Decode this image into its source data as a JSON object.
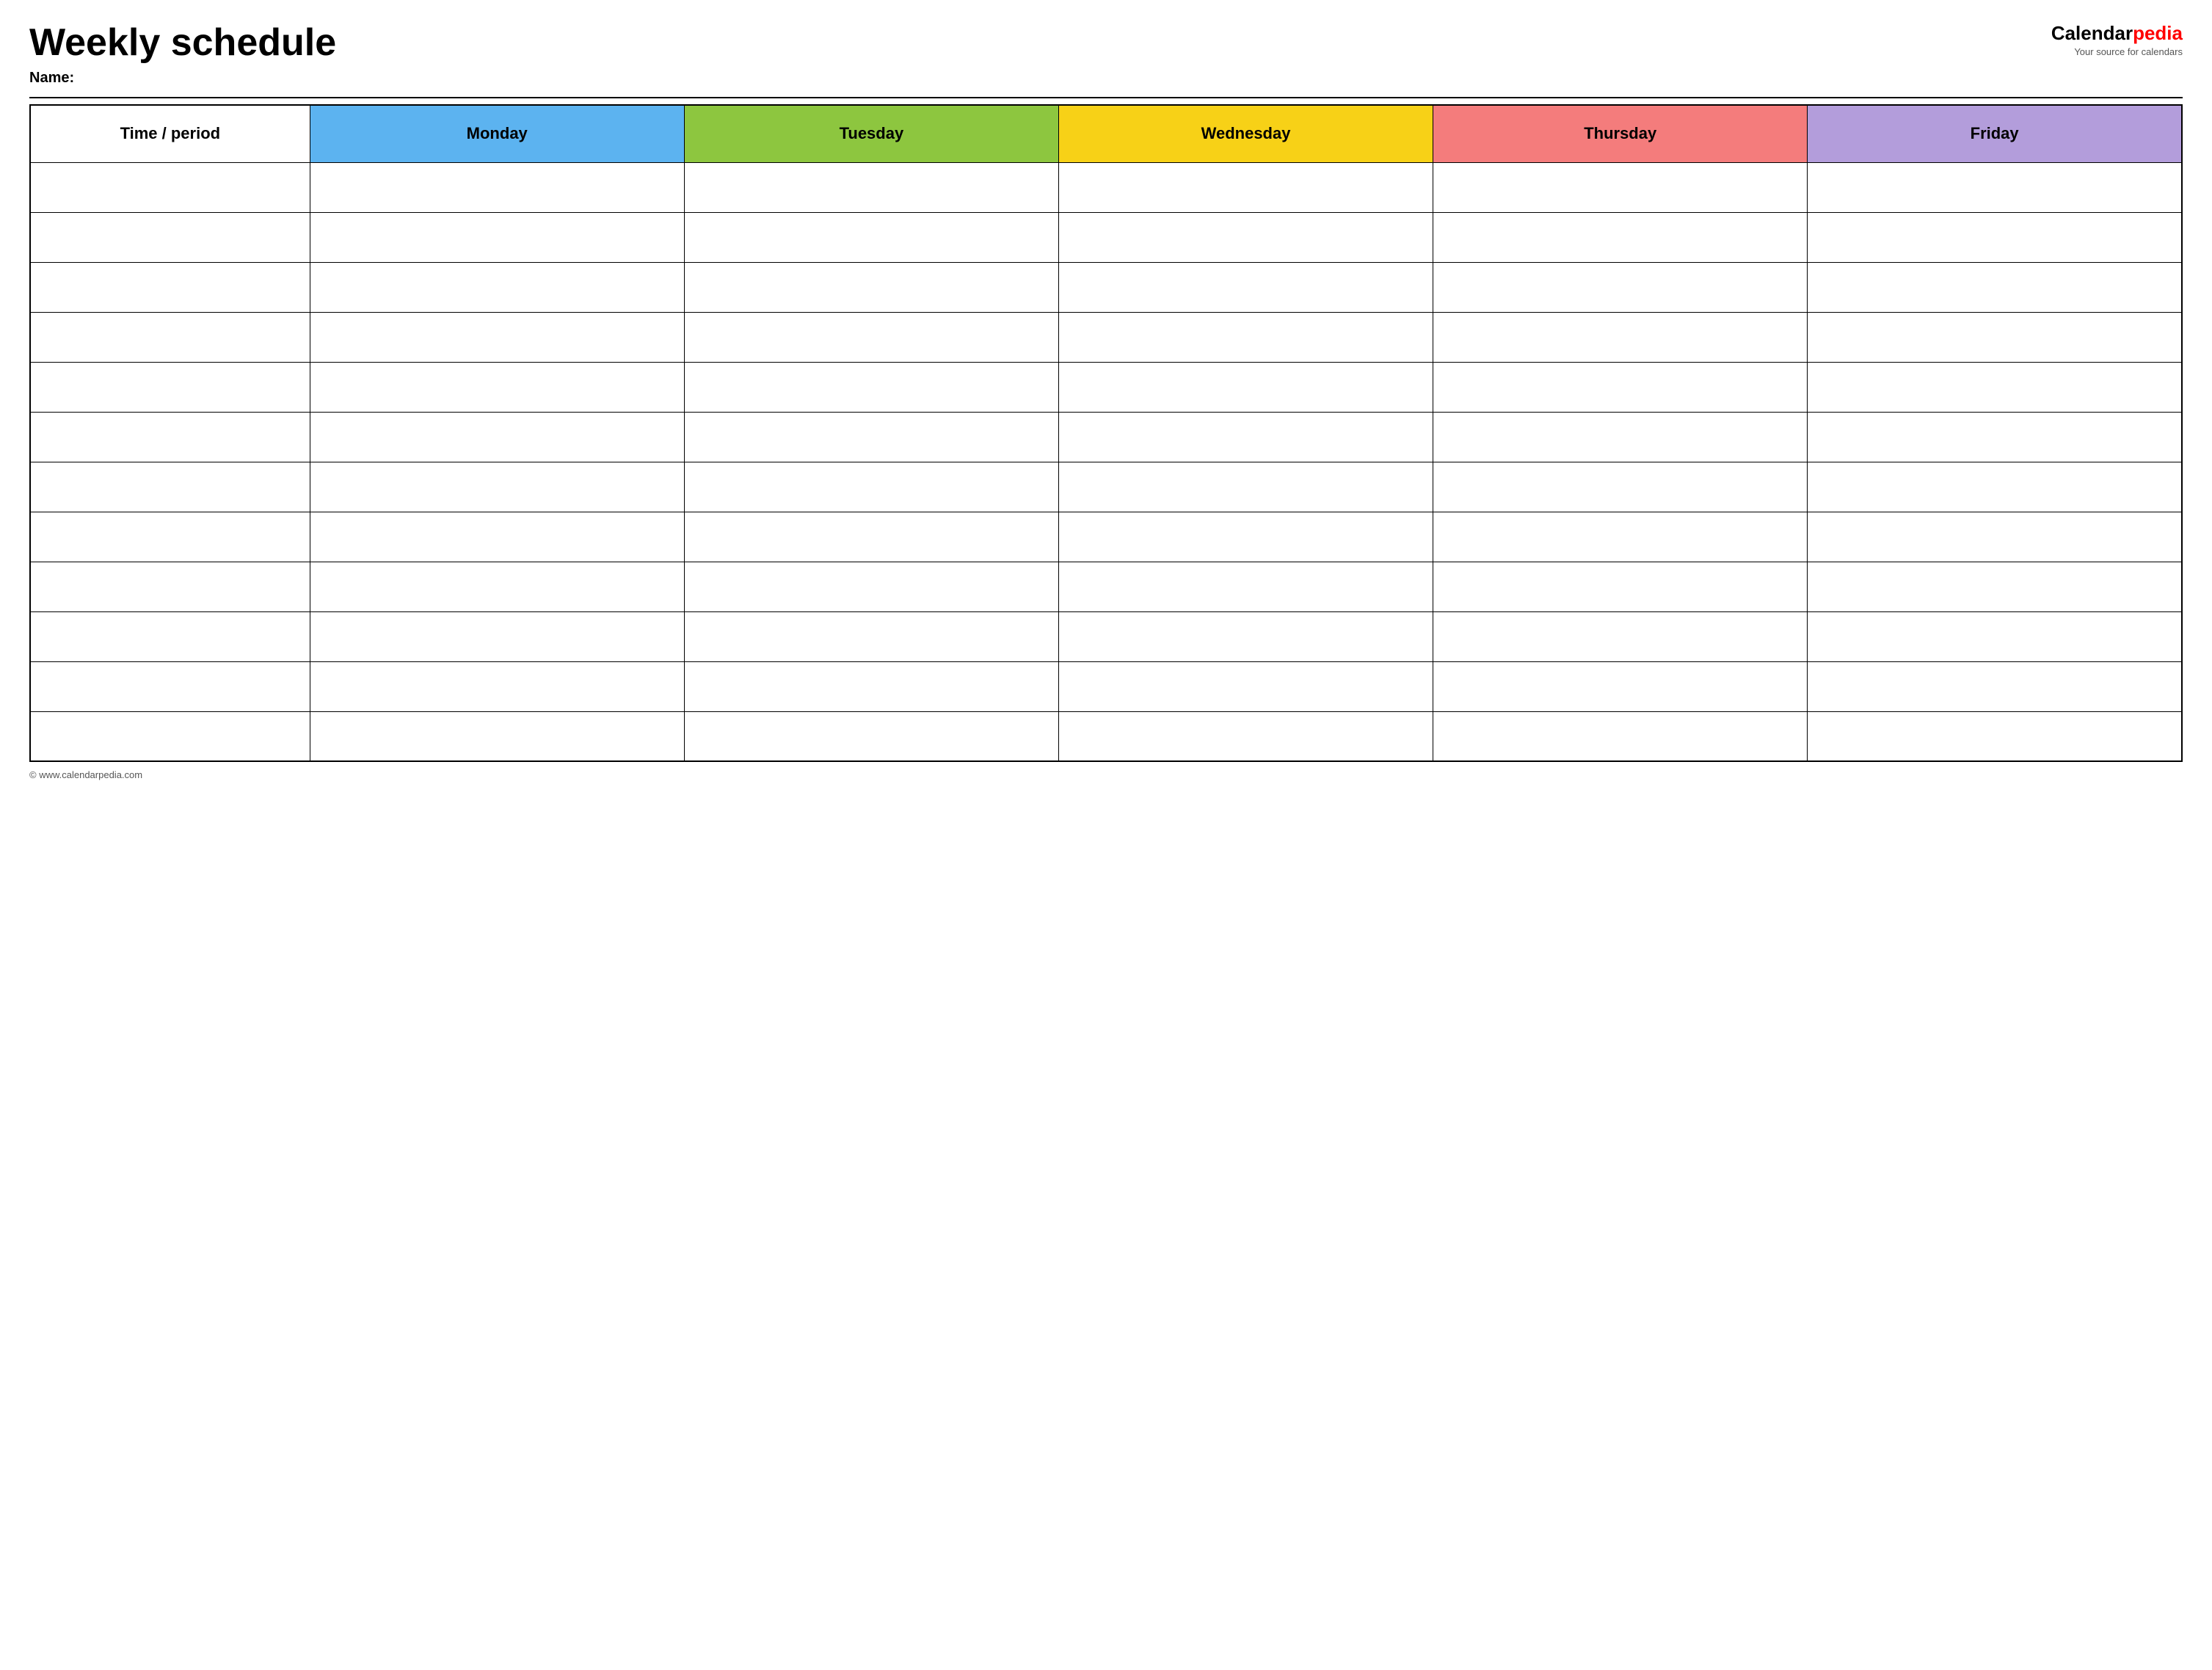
{
  "header": {
    "title": "Weekly schedule",
    "name_label": "Name:",
    "logo": {
      "brand_prefix": "Calendar",
      "brand_suffix": "pedia",
      "tagline": "Your source for calendars"
    }
  },
  "table": {
    "columns": [
      {
        "id": "time",
        "label": "Time / period",
        "color": "#ffffff"
      },
      {
        "id": "monday",
        "label": "Monday",
        "color": "#5cb3f0"
      },
      {
        "id": "tuesday",
        "label": "Tuesday",
        "color": "#8dc63f"
      },
      {
        "id": "wednesday",
        "label": "Wednesday",
        "color": "#f7d117"
      },
      {
        "id": "thursday",
        "label": "Thursday",
        "color": "#f47c7c"
      },
      {
        "id": "friday",
        "label": "Friday",
        "color": "#b39ddb"
      }
    ],
    "row_count": 12
  },
  "footer": {
    "url": "© www.calendarpedia.com"
  }
}
